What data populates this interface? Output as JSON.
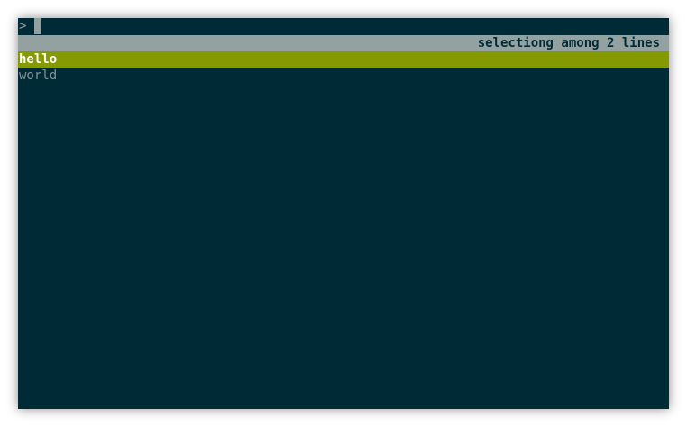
{
  "prompt": {
    "symbol": ">",
    "query": ""
  },
  "status": {
    "text": "selectiong among 2 lines"
  },
  "lines": [
    {
      "text": "hello",
      "selected": true
    },
    {
      "text": "world",
      "selected": false
    }
  ],
  "colors": {
    "background": "#002b36",
    "status_bar": "#93a1a1",
    "selection": "#859900",
    "text": "#839496"
  }
}
